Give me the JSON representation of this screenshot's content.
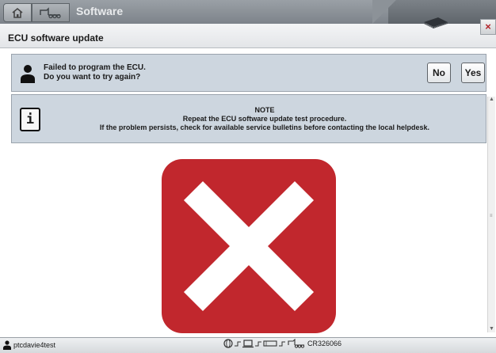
{
  "topbar": {
    "breadcrumb_title": "Software",
    "home_icon": "home-icon",
    "vehicle_icon": "vehicle-icon",
    "chip_icon": "ecu-chip-icon",
    "close_label": "×"
  },
  "header": {
    "title": "ECU software update"
  },
  "prompt": {
    "line1": "Failed to program the ECU.",
    "line2": "Do you want to try again?",
    "no_label": "No",
    "yes_label": "Yes"
  },
  "note": {
    "heading": "NOTE",
    "line1": "Repeat the ECU software update test procedure.",
    "line2": "If the problem persists, check for available service bulletins before contacting the local helpdesk.",
    "info_glyph": "i"
  },
  "result": {
    "icon": "error-x-icon",
    "color": "#c1272d"
  },
  "statusbar": {
    "username": "ptcdavie4test",
    "device_id": "CR326066"
  }
}
